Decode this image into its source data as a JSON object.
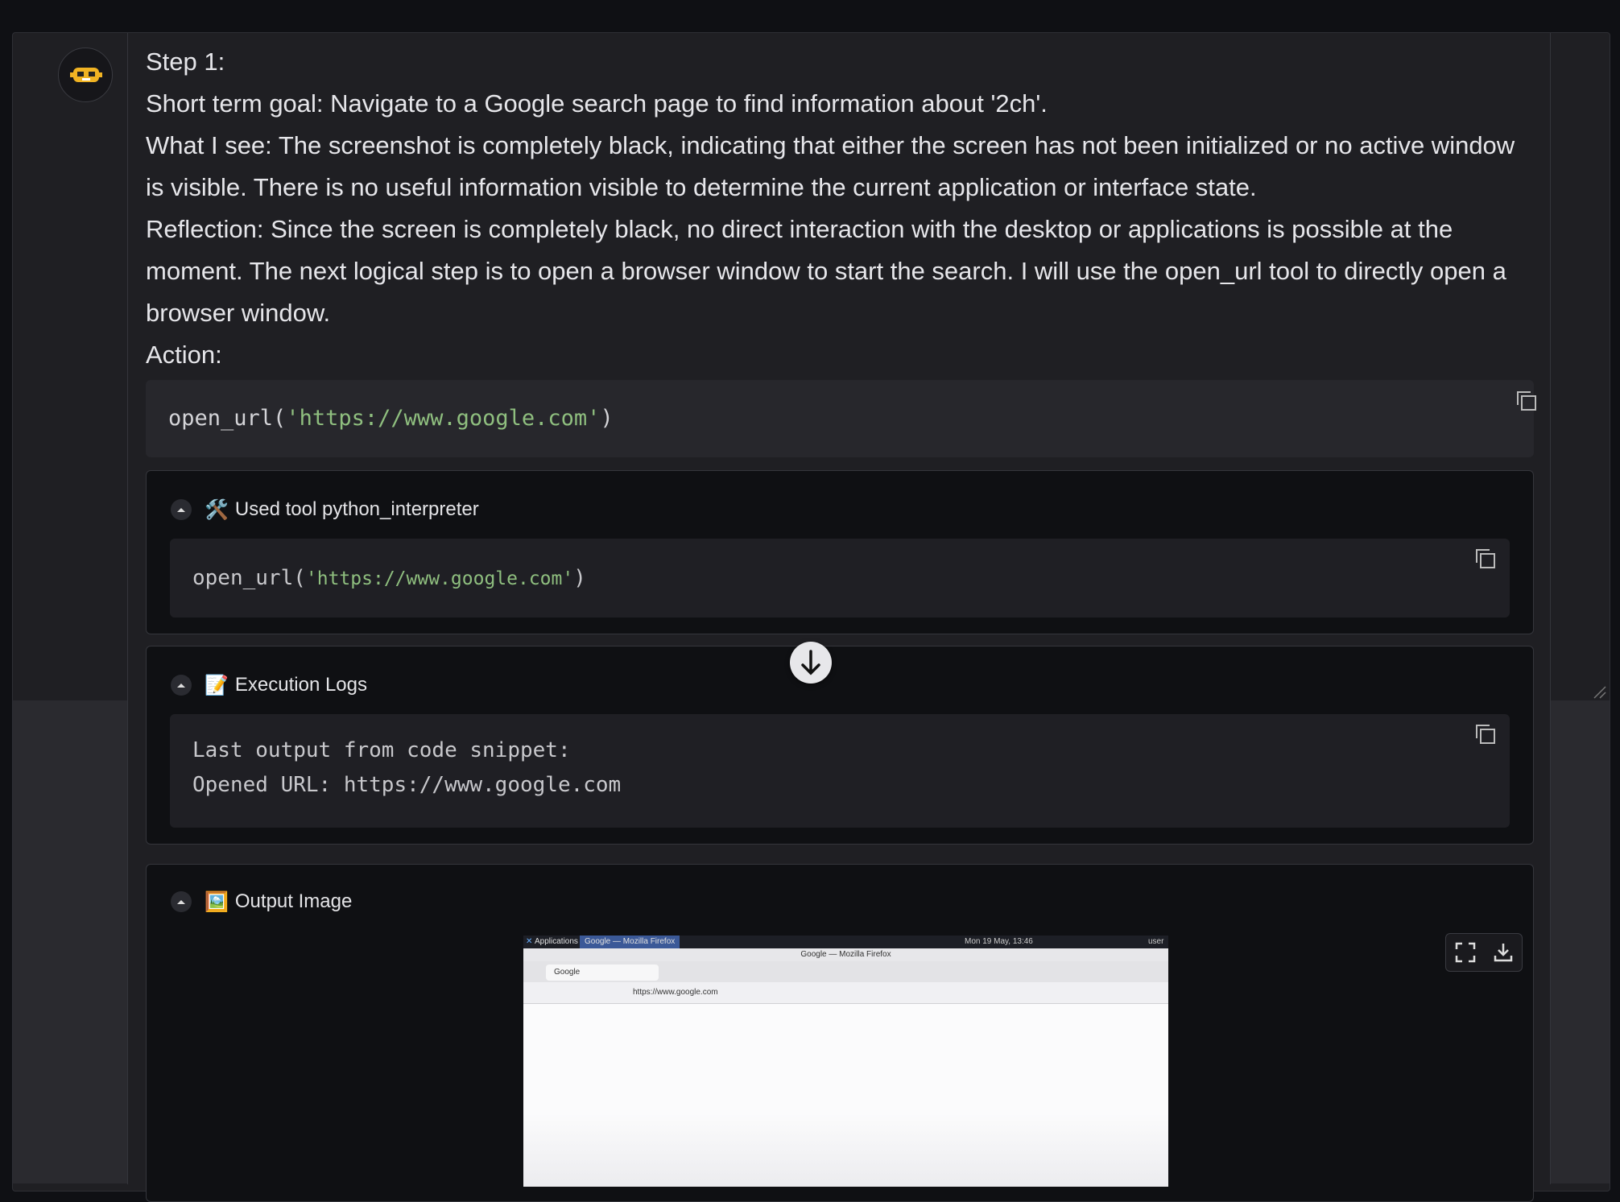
{
  "step": {
    "title": "Step 1:",
    "short_term_goal": "Short term goal: Navigate to a Google search page to find information about '2ch'.",
    "what_i_see": "What I see: The screenshot is completely black, indicating that either the screen has not been initialized or no active window is visible. There is no useful information visible to determine the current application or interface state.",
    "reflection": "Reflection: Since the screen is completely black, no direct interaction with the desktop or applications is possible at the moment. The next logical step is to open a browser window to start the search. I will use the open_url tool to directly open a browser window.",
    "action_label": "Action:"
  },
  "action_code": {
    "fn": "open_url",
    "arg": "'https://www.google.com'"
  },
  "tool_panel": {
    "emoji": "🛠️",
    "title": "Used tool python_interpreter",
    "fn": "open_url",
    "arg": "'https://www.google.com'"
  },
  "logs_panel": {
    "emoji": "📝",
    "title": "Execution Logs",
    "line1": "Last output from code snippet:",
    "line2": "Opened URL: https://www.google.com"
  },
  "image_panel": {
    "emoji": "🖼️",
    "title": "Output Image"
  },
  "screenshot": {
    "taskbar_apps": "Applications :",
    "taskbar_window": "Google — Mozilla Firefox",
    "taskbar_clock": "Mon 19 May, 13:46",
    "taskbar_user": "user",
    "window_title": "Google — Mozilla Firefox",
    "tab_label": "Google",
    "url": "https://www.google.com"
  },
  "colors": {
    "background": "#0f1014",
    "panel": "#1f1f23",
    "string": "#8fbf7f"
  }
}
